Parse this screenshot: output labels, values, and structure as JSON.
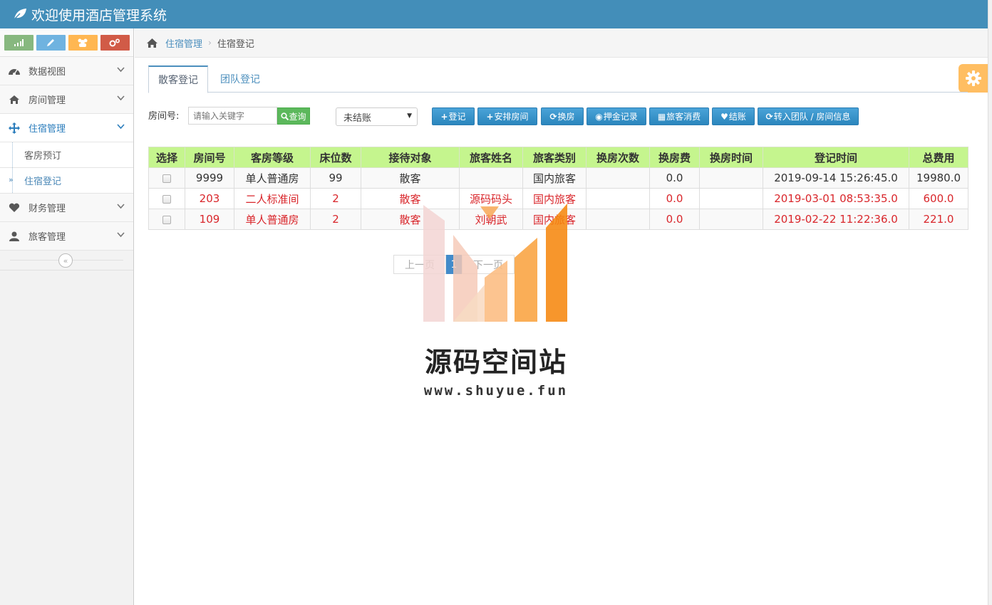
{
  "app": {
    "title": "欢迎使用酒店管理系统"
  },
  "sidebar": {
    "items": [
      {
        "label": "数据视图",
        "icon": "dashboard-icon"
      },
      {
        "label": "房间管理",
        "icon": "home-icon"
      },
      {
        "label": "住宿管理",
        "icon": "move-icon",
        "open": true
      },
      {
        "label": "财务管理",
        "icon": "heart-icon"
      },
      {
        "label": "旅客管理",
        "icon": "user-icon"
      }
    ],
    "subitems": [
      {
        "label": "客房预订"
      },
      {
        "label": "住宿登记",
        "active": true
      }
    ]
  },
  "breadcrumb": {
    "parent": "住宿管理",
    "current": "住宿登记"
  },
  "tabs": [
    {
      "label": "散客登记",
      "active": true
    },
    {
      "label": "团队登记",
      "active": false
    }
  ],
  "toolbar": {
    "room_label": "房间号:",
    "search_placeholder": "请输入关键字",
    "query_label": "查询",
    "status_value": "未结账",
    "buttons": [
      {
        "label": "登记",
        "glyph": "+"
      },
      {
        "label": "安排房间",
        "glyph": "+"
      },
      {
        "label": "换房",
        "glyph": "⟳"
      },
      {
        "label": "押金记录",
        "glyph": "◉"
      },
      {
        "label": "旅客消费",
        "glyph": "▦"
      },
      {
        "label": "结账",
        "glyph": "♥"
      },
      {
        "label": "转入团队 / 房间信息",
        "glyph": "⟳"
      }
    ]
  },
  "table": {
    "columns": [
      "选择",
      "房间号",
      "客房等级",
      "床位数",
      "接待对象",
      "旅客姓名",
      "旅客类别",
      "换房次数",
      "换房费",
      "换房时间",
      "登记时间",
      "总费用"
    ],
    "rows": [
      [
        "",
        "9999",
        "单人普通房",
        "99",
        "散客",
        "",
        "国内旅客",
        "",
        "0.0",
        "",
        "2019-09-14 15:26:45.0",
        "19980.0"
      ],
      [
        "",
        "203",
        "二人标准间",
        "2",
        "散客",
        "源码码头",
        "国内旅客",
        "",
        "0.0",
        "",
        "2019-03-01 08:53:35.0",
        "600.0"
      ],
      [
        "",
        "109",
        "单人普通房",
        "2",
        "散客",
        "刘朝武",
        "国内旅客",
        "",
        "0.0",
        "",
        "2019-02-22 11:22:36.0",
        "221.0"
      ]
    ]
  },
  "pager": {
    "prev": "上一页",
    "current": "1",
    "next": "下一页"
  },
  "watermark": {
    "name": "源码空间站",
    "url": "www.shuyue.fun"
  },
  "colors": {
    "navbar": "#438eb9",
    "accent": "#4c8fbd",
    "header_row": "#c5f58e",
    "alert_text": "#d9262b",
    "settings": "#ffb752"
  }
}
